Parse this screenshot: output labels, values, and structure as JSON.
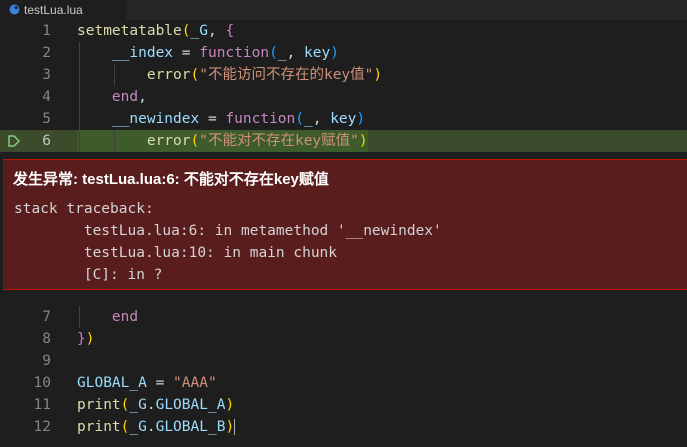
{
  "tab": {
    "title": "testLua.lua"
  },
  "lines": [
    {
      "n": "1",
      "parts": [
        [
          "fn",
          "setmetatable"
        ],
        [
          "br",
          "("
        ],
        [
          "var",
          "_G"
        ],
        [
          "pun",
          ", "
        ],
        [
          "br2",
          "{"
        ]
      ]
    },
    {
      "n": "2",
      "parts": [
        [
          "var",
          "    __index"
        ],
        [
          "pun",
          " = "
        ],
        [
          "kw",
          "function"
        ],
        [
          "br3",
          "("
        ],
        [
          "var",
          "_"
        ],
        [
          "pun",
          ", "
        ],
        [
          "var",
          "key"
        ],
        [
          "br3",
          ")"
        ]
      ]
    },
    {
      "n": "3",
      "parts": [
        [
          "fn",
          "        error"
        ],
        [
          "br",
          "("
        ],
        [
          "str",
          "\"不能访问不存在的key值\""
        ],
        [
          "br",
          ")"
        ]
      ]
    },
    {
      "n": "4",
      "parts": [
        [
          "kw",
          "    end"
        ],
        [
          "pun",
          ","
        ]
      ]
    },
    {
      "n": "5",
      "parts": [
        [
          "var",
          "    __newindex"
        ],
        [
          "pun",
          " = "
        ],
        [
          "kw",
          "function"
        ],
        [
          "br3",
          "("
        ],
        [
          "var",
          "_"
        ],
        [
          "pun",
          ", "
        ],
        [
          "var",
          "key"
        ],
        [
          "br3",
          ")"
        ]
      ]
    },
    {
      "n": "6",
      "parts": [
        [
          "fn",
          "        error"
        ],
        [
          "br",
          "("
        ],
        [
          "str",
          "\"不能对不存在key赋值\""
        ],
        [
          "br",
          ")"
        ]
      ]
    },
    {
      "n": "7",
      "parts": [
        [
          "kw",
          "    end"
        ]
      ]
    },
    {
      "n": "8",
      "parts": [
        [
          "br2",
          "}"
        ],
        [
          "br",
          ")"
        ]
      ]
    },
    {
      "n": "9",
      "parts": []
    },
    {
      "n": "10",
      "parts": [
        [
          "var",
          "GLOBAL_A"
        ],
        [
          "pun",
          " = "
        ],
        [
          "str",
          "\"AAA\""
        ]
      ]
    },
    {
      "n": "11",
      "parts": [
        [
          "fn",
          "print"
        ],
        [
          "br",
          "("
        ],
        [
          "var",
          "_G"
        ],
        [
          "pun",
          "."
        ],
        [
          "var",
          "GLOBAL_A"
        ],
        [
          "br",
          ")"
        ]
      ]
    },
    {
      "n": "12",
      "parts": [
        [
          "fn",
          "print"
        ],
        [
          "br",
          "("
        ],
        [
          "var",
          "_G"
        ],
        [
          "pun",
          "."
        ],
        [
          "var",
          "GLOBAL_B"
        ],
        [
          "br",
          ")"
        ]
      ]
    }
  ],
  "exception": {
    "title": "发生异常: testLua.lua:6: 不能对不存在key赋值",
    "body": "stack traceback:\n\ttestLua.lua:6: in metamethod '__newindex'\n\ttestLua.lua:10: in main chunk\n\t[C]: in ?"
  },
  "colors": {
    "editor_bg": "#1e1e1e",
    "exception_bg": "#5a1d1d",
    "active_line_bg": "#3e5b2b",
    "breakpoint": "#89d185"
  }
}
